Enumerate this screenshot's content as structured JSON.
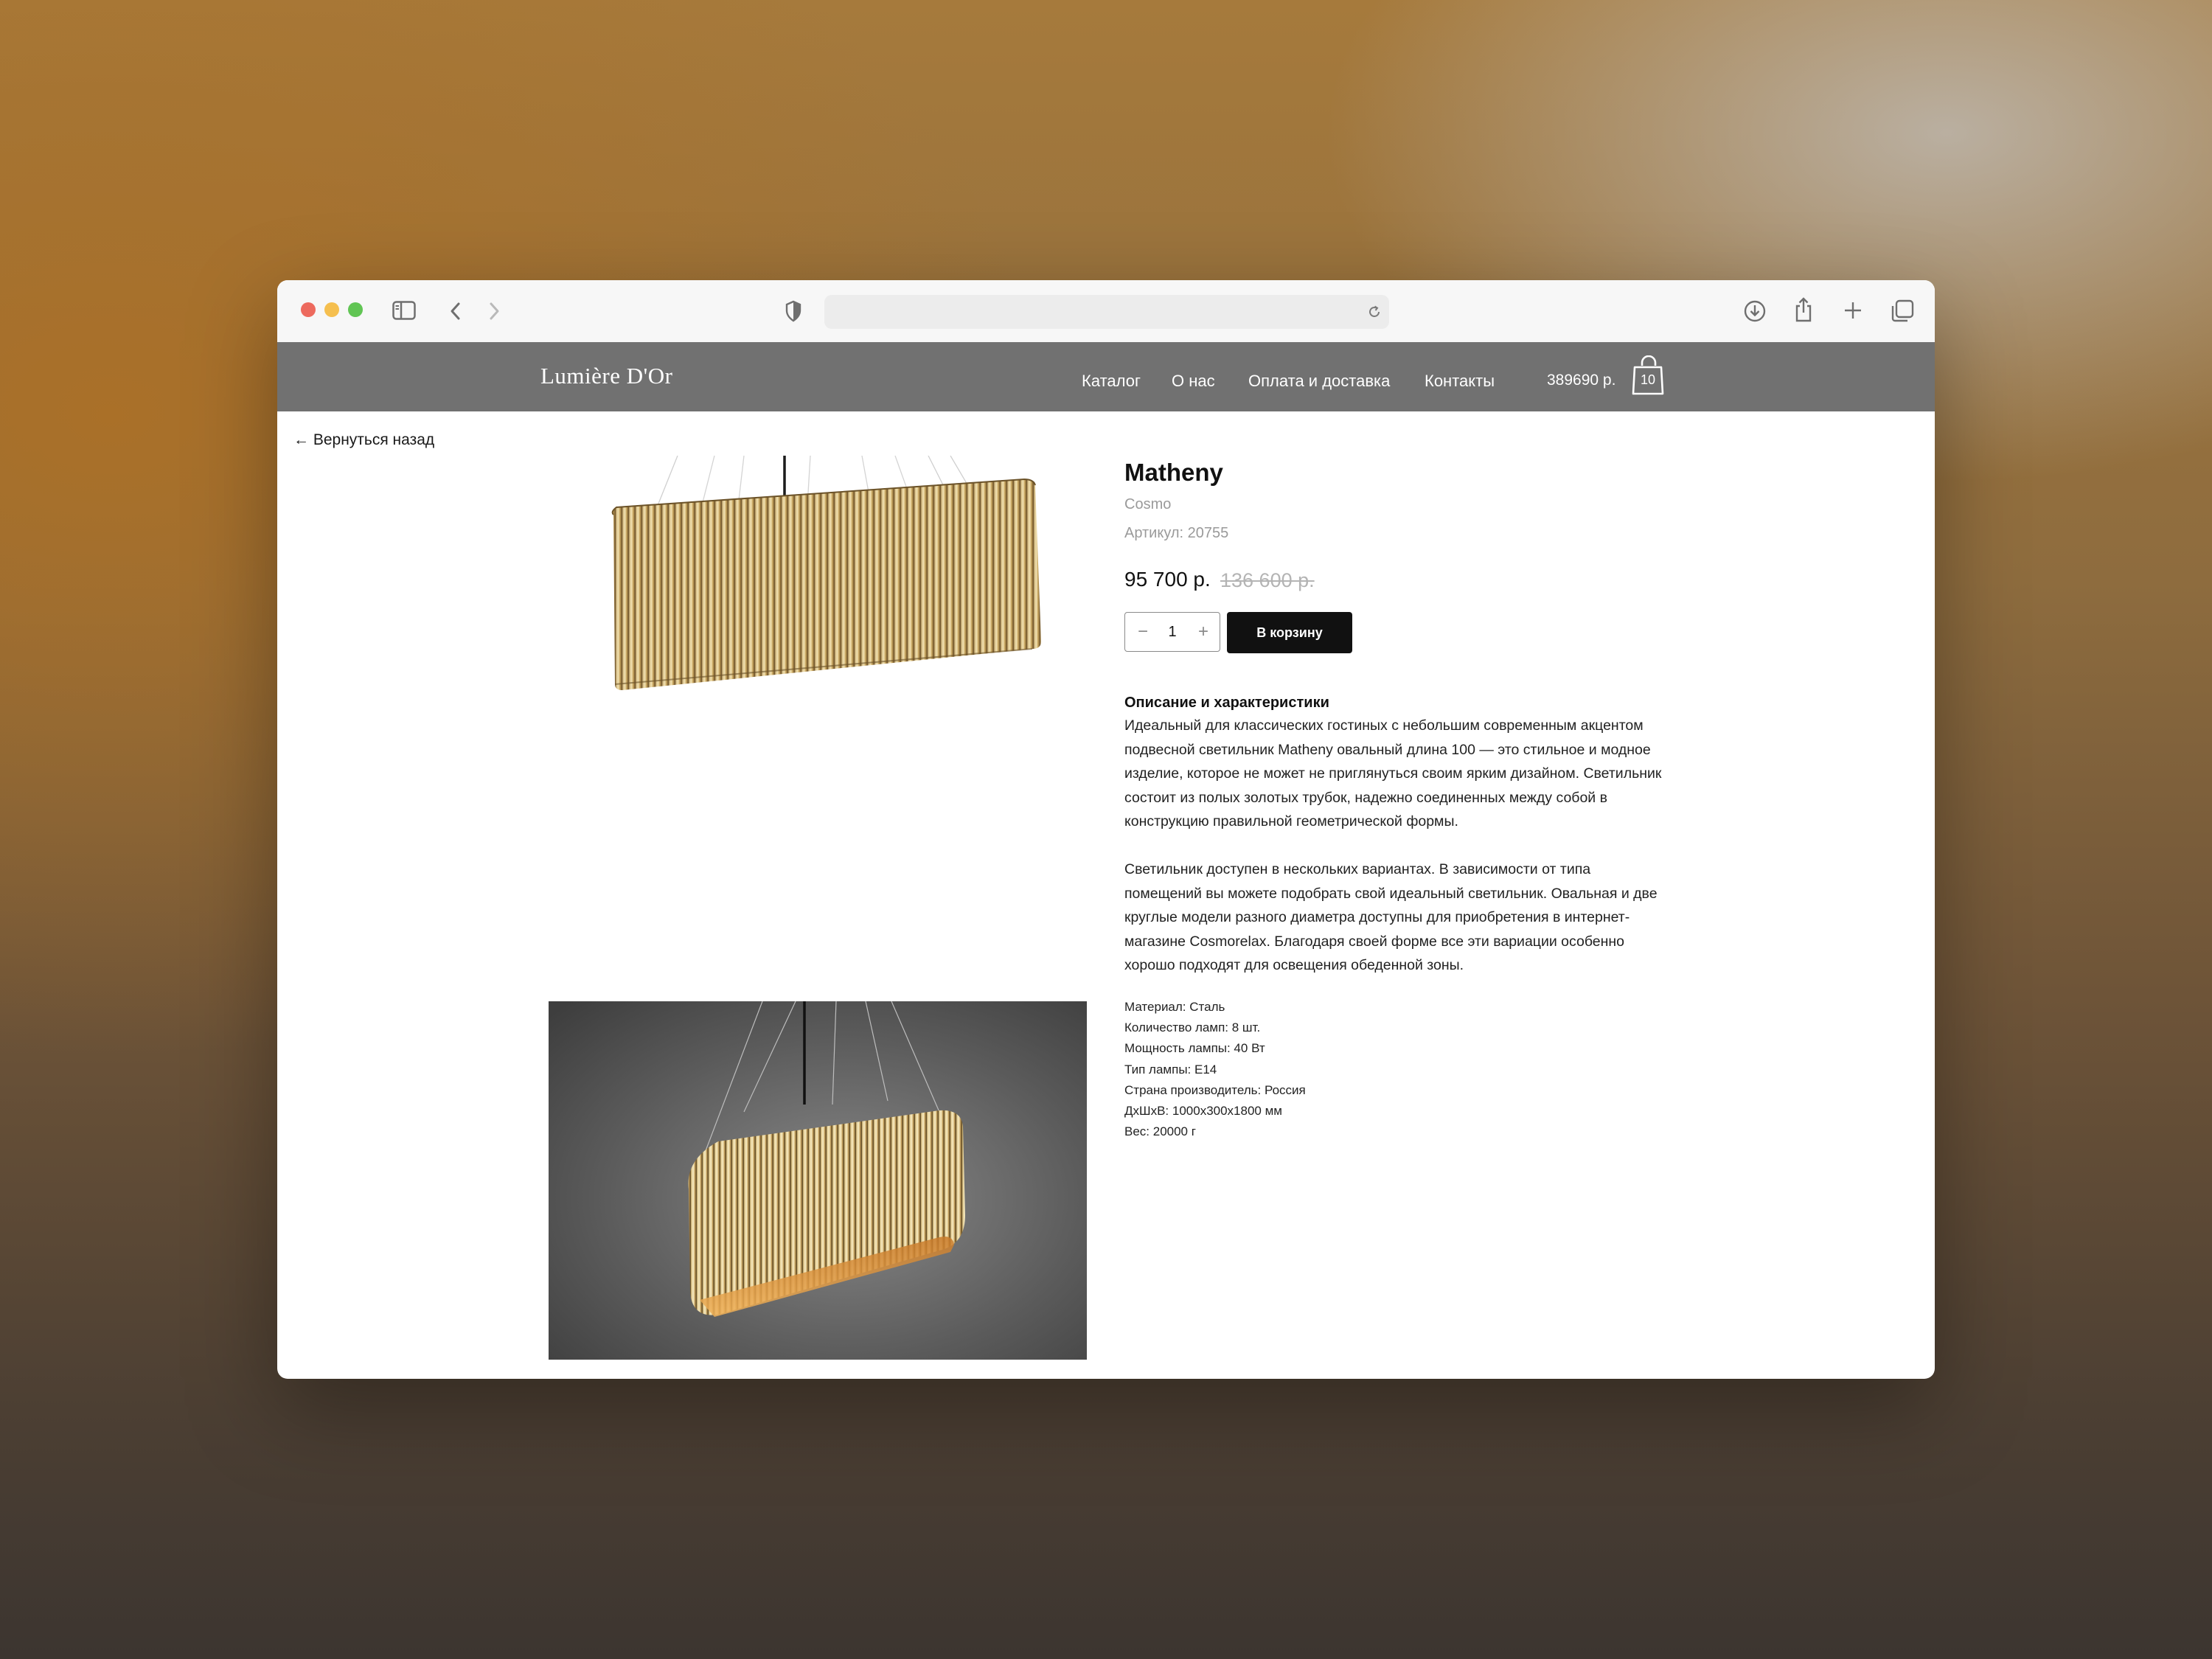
{
  "site": {
    "logo": "Lumière D'Or",
    "nav": [
      "Каталог",
      "О нас",
      "Оплата и доставка",
      "Контакты"
    ],
    "cart_total": "389690 р.",
    "cart_count": "10"
  },
  "back_link": "← Вернуться назад",
  "product": {
    "name": "Matheny",
    "brand": "Cosmo",
    "sku": "Артикул: 20755",
    "price": "95 700 р.",
    "old_price": "136 600 р.",
    "quantity": "1",
    "add_to_cart": "В корзину",
    "description_heading": "Описание и характеристики",
    "description": [
      "Идеальный для классических гостиных с небольшим современным акцентом подвесной светильник Matheny овальный длина 100 — это стильное и модное изделие, которое не может не приглянуться своим ярким дизайном. Светильник состоит из полых золотых трубок, надежно соединенных между собой в конструкцию правильной геометрической формы.",
      "Светильник доступен в нескольких вариантах. В зависимости от типа помещений вы можете подобрать свой идеальный светильник. Овальная и две круглые модели разного диаметра доступны для приобретения в интернет-магазине Cosmorelax. Благодаря своей форме все эти вариации особенно хорошо подходят для освещения обеденной зоны."
    ],
    "specs": [
      "Материал: Сталь",
      "Количество ламп: 8 шт.",
      "Мощность лампы: 40 Вт",
      "Тип лампы: E14",
      "Страна производитель: Россия",
      "ДхШхВ: 1000x300x1800 мм",
      "Вес: 20000 г"
    ]
  },
  "colors": {
    "header_bg": "#717171",
    "button_bg": "#111111",
    "gold": "#c8a860"
  }
}
